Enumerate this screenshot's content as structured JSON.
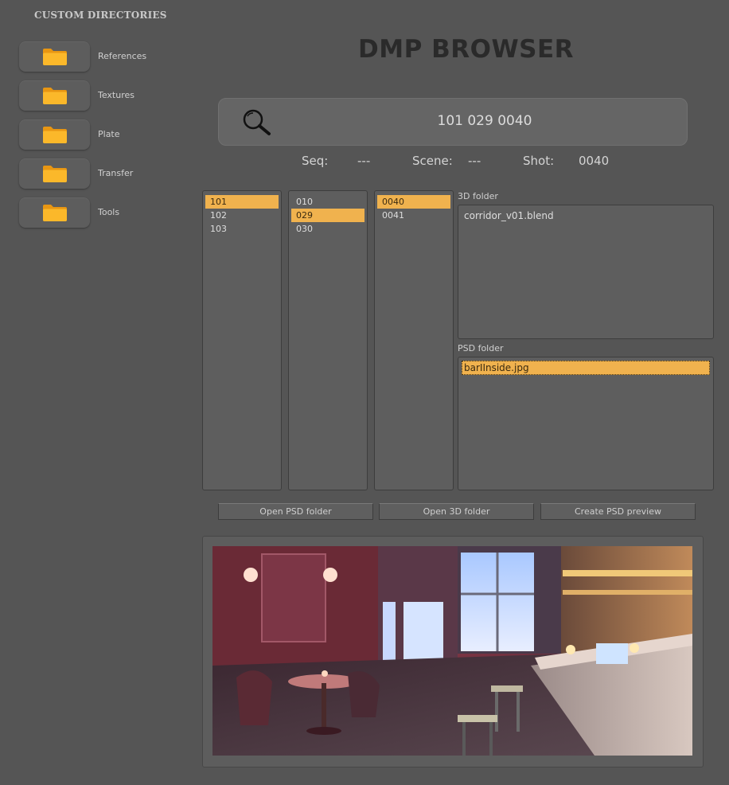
{
  "sidebar": {
    "title": "CUSTOM DIRECTORIES",
    "items": [
      {
        "label": "References",
        "icon": "folder-icon"
      },
      {
        "label": "Textures",
        "icon": "folder-icon"
      },
      {
        "label": "Plate",
        "icon": "folder-icon"
      },
      {
        "label": "Transfer",
        "icon": "folder-icon"
      },
      {
        "label": "Tools",
        "icon": "folder-icon"
      }
    ]
  },
  "header": {
    "title": "DMP BROWSER"
  },
  "search": {
    "value": "101 029 0040",
    "icon": "search-icon"
  },
  "info": {
    "seq_label": "Seq:",
    "seq_value": "---",
    "scene_label": "Scene:",
    "scene_value": "---",
    "shot_label": "Shot:",
    "shot_value": "0040"
  },
  "lists": {
    "sequences": [
      "101",
      "102",
      "103"
    ],
    "sequences_selected": "101",
    "scenes": [
      "010",
      "029",
      "030"
    ],
    "scenes_selected": "029",
    "shots": [
      "0040",
      "0041"
    ],
    "shots_selected": "0040"
  },
  "folders": {
    "folder_3d_label": "3D folder",
    "files_3d": [
      "corridor_v01.blend"
    ],
    "folder_psd_label": "PSD folder",
    "files_psd": [
      "barIInside.jpg"
    ],
    "files_psd_selected": "barIInside.jpg"
  },
  "actions": {
    "open_psd": "Open PSD folder",
    "open_3d": "Open 3D folder",
    "create_preview": "Create PSD preview"
  },
  "colors": {
    "background": "#555555",
    "selection": "#f0b24e",
    "folder_icon": "#f5a91c"
  },
  "preview": {
    "subject": "bar interior render"
  }
}
